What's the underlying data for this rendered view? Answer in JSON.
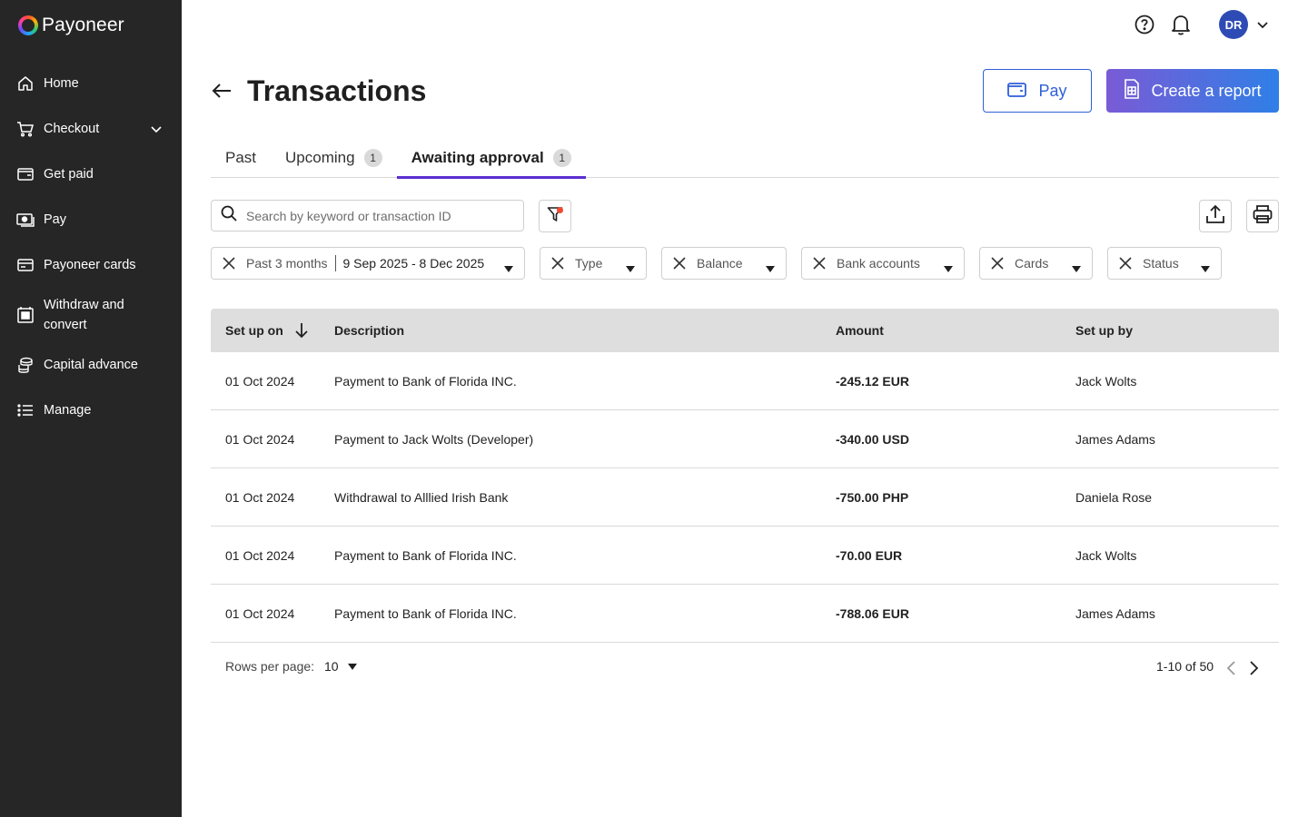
{
  "brand": {
    "name": "Payoneer"
  },
  "sidebar": {
    "items": [
      {
        "label": "Home",
        "icon": "home-icon"
      },
      {
        "label": "Checkout",
        "icon": "cart-icon",
        "expandable": true
      },
      {
        "label": "Get paid",
        "icon": "wallet-icon"
      },
      {
        "label": "Pay",
        "icon": "cash-icon"
      },
      {
        "label": "Payoneer cards",
        "icon": "card-icon"
      },
      {
        "label": "Withdraw and convert",
        "icon": "withdraw-icon"
      },
      {
        "label": "Capital advance",
        "icon": "coins-icon"
      },
      {
        "label": "Manage",
        "icon": "list-icon"
      }
    ]
  },
  "topbar": {
    "avatar_initials": "DR"
  },
  "header": {
    "title": "Transactions",
    "pay_label": "Pay",
    "report_label": "Create a report"
  },
  "tabs": [
    {
      "label": "Past",
      "badge": null,
      "active": false
    },
    {
      "label": "Upcoming",
      "badge": "1",
      "active": false
    },
    {
      "label": "Awaiting approval",
      "badge": "1",
      "active": true
    }
  ],
  "search": {
    "placeholder": "Search by keyword or transaction ID",
    "value": ""
  },
  "filters": {
    "period_label": "Past 3 months",
    "period_range": "9 Sep 2025 - 8 Dec 2025",
    "type_label": "Type",
    "balance_label": "Balance",
    "bank_accounts_label": "Bank accounts",
    "cards_label": "Cards",
    "status_label": "Status"
  },
  "table": {
    "columns": [
      "Set up on",
      "Description",
      "Amount",
      "Set up by"
    ],
    "sort_column": "Set up on",
    "rows": [
      {
        "date": "01 Oct 2024",
        "description": "Payment to Bank of Florida INC.",
        "amount": "-245.12 EUR",
        "setup_by": "Jack Wolts"
      },
      {
        "date": "01 Oct 2024",
        "description": "Payment to Jack Wolts (Developer)",
        "amount": "-340.00 USD",
        "setup_by": "James Adams"
      },
      {
        "date": "01 Oct 2024",
        "description": "Withdrawal to Alllied Irish Bank",
        "amount": "-750.00 PHP",
        "setup_by": "Daniela Rose"
      },
      {
        "date": "01 Oct 2024",
        "description": "Payment to Bank of Florida INC.",
        "amount": "-70.00 EUR",
        "setup_by": "Jack Wolts"
      },
      {
        "date": "01 Oct 2024",
        "description": "Payment to Bank of Florida INC.",
        "amount": "-788.06 EUR",
        "setup_by": "James Adams"
      }
    ]
  },
  "pagination": {
    "rows_per_page_label": "Rows per page:",
    "rows_per_page": "10",
    "range": "1-10 of 50"
  },
  "colors": {
    "sidebar_bg": "#262626",
    "accent_purple": "#5a2fd1",
    "pay_blue": "#2f5fd8",
    "avatar_blue": "#2e4bb5",
    "filter_dot": "#f24a2e"
  }
}
